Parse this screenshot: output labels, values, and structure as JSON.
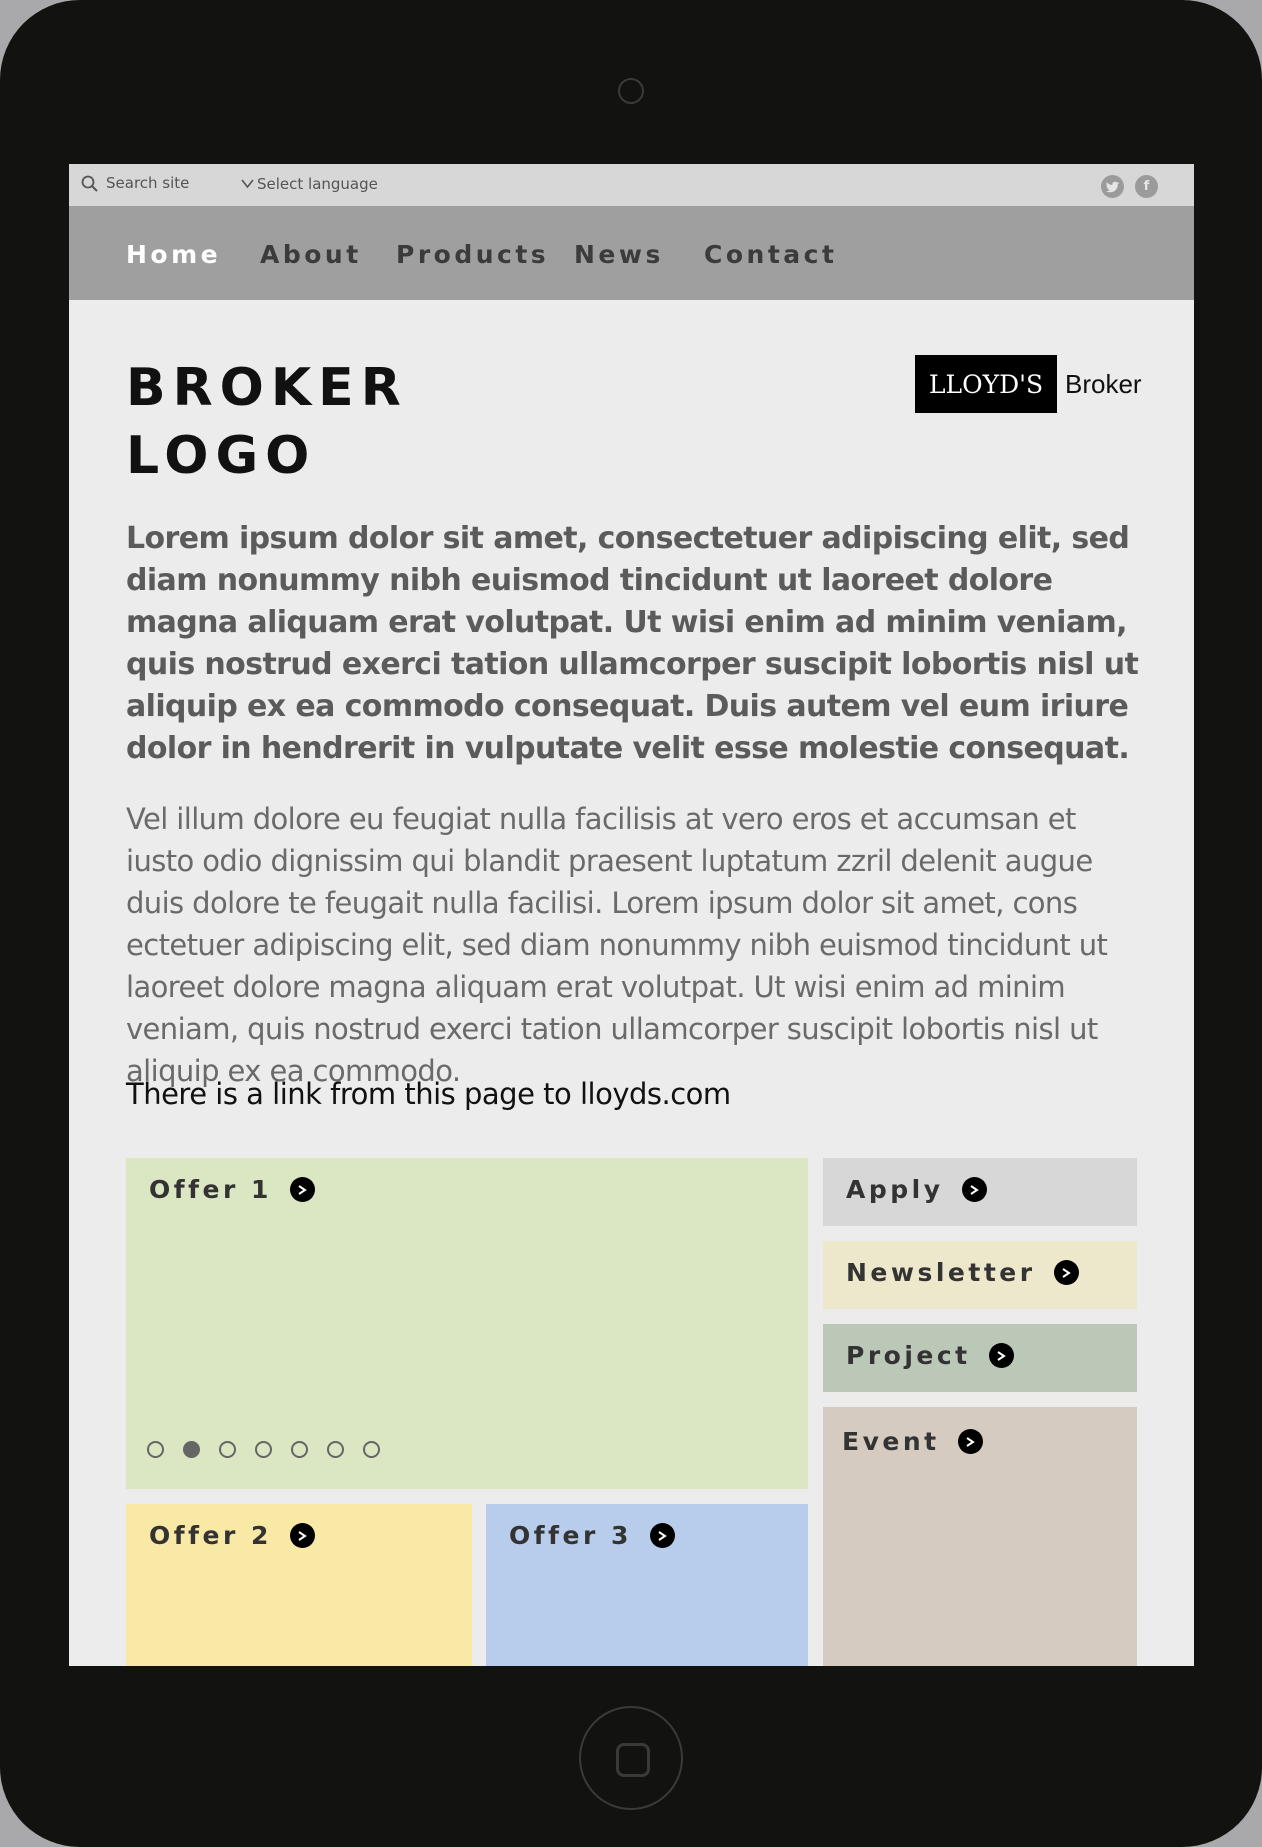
{
  "utility_bar": {
    "search_placeholder": "Search site",
    "language_label": "Select language",
    "social": [
      {
        "icon": "twitter-icon",
        "glyph": "t"
      },
      {
        "icon": "facebook-icon",
        "glyph": "f"
      }
    ]
  },
  "nav": {
    "items": [
      {
        "label": "Home",
        "active": true
      },
      {
        "label": "About"
      },
      {
        "label": "Products"
      },
      {
        "label": "News"
      },
      {
        "label": "Contact"
      }
    ]
  },
  "header": {
    "broker_logo_line1": "BROKER",
    "broker_logo_line2": "LOGO",
    "lloyds_badge": "LLOYD'S",
    "lloyds_broker": "Broker"
  },
  "content": {
    "lead": "Lorem ipsum dolor sit amet, consectetuer adipiscing elit, sed diam nonummy nibh euismod tincidunt ut laoreet dolore magna aliquam erat volutpat. Ut wisi enim ad minim veniam, quis nostrud exerci tation ullamcorper suscipit lobortis nisl ut aliquip ex ea commodo consequat. Duis autem vel eum iriure dolor in hendrerit in vulputate velit esse molestie consequat.",
    "body": "Vel illum dolore eu feugiat nulla facilisis at vero eros et accumsan et iusto odio dignissim qui blandit praesent luptatum zzril delenit augue duis dolore te feugait nulla facilisi. Lorem ipsum dolor sit amet, cons ectetuer adipiscing elit, sed diam nonummy nibh euismod tincidunt ut laoreet dolore magna aliquam erat volutpat. Ut wisi enim ad minim veniam, quis nostrud exerci tation ullamcorper suscipit lobortis nisl ut aliquip ex ea commodo.",
    "link_note": "There is a link from this page to lloyds.com"
  },
  "tiles": {
    "offer1": {
      "label": "Offer 1",
      "color": "#dbe6c2"
    },
    "offer2": {
      "label": "Offer 2",
      "color": "#f9e9a6"
    },
    "offer3": {
      "label": "Offer 3",
      "color": "#b8ccec"
    },
    "apply": {
      "label": "Apply",
      "color": "#d7d7d7"
    },
    "newsletter": {
      "label": "Newsletter",
      "color": "#ede8cb"
    },
    "project": {
      "label": "Project",
      "color": "#bbc8b8"
    },
    "event": {
      "label": "Event",
      "color": "#d6cbc1"
    }
  },
  "carousel": {
    "total": 7,
    "active_index": 1
  },
  "colors": {
    "utility_bar": "#d7d7d7",
    "nav_bar": "#9f9f9f",
    "nav_active": "#ffffff",
    "screen_bg": "#ececec",
    "device_frame": "#121210"
  }
}
